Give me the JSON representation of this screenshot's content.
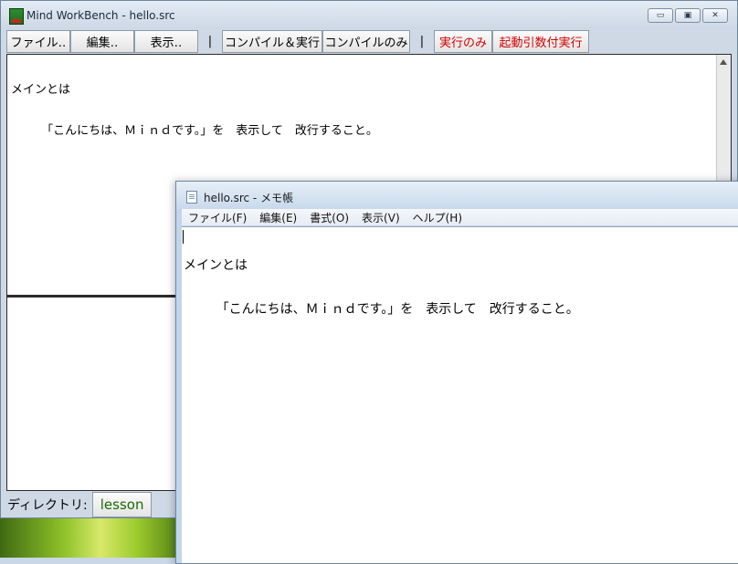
{
  "workbench": {
    "title": "Mind WorkBench - hello.src",
    "window_controls": {
      "minimize": "▭",
      "maximize": "▣",
      "close": "✕"
    },
    "toolbar": {
      "file": "ファイル‥",
      "edit": "編集‥",
      "view": "表示‥",
      "separator": "|",
      "compile_run": "コンパイル＆実行",
      "compile_only": "コンパイルのみ",
      "run_only": "実行のみ",
      "run_with_args": "起動引数付実行"
    },
    "source_lines": [
      "メインとは",
      "\t「こんにちは、Ｍｉｎｄです。」を　表示して　改行すること。"
    ],
    "directory_label": "ディレクトリ:",
    "directory_value": "lesson"
  },
  "notepad": {
    "title": "hello.src - メモ帳",
    "menu": [
      "ファイル(F)",
      "編集(E)",
      "書式(O)",
      "表示(V)",
      "ヘルプ(H)"
    ],
    "lines": [
      "メインとは",
      "\t「こんにちは、Ｍｉｎｄです。」を　表示して　改行すること。"
    ]
  },
  "colors": {
    "run_buttons_text": "#d40000",
    "directory_text": "#1a6a00"
  }
}
